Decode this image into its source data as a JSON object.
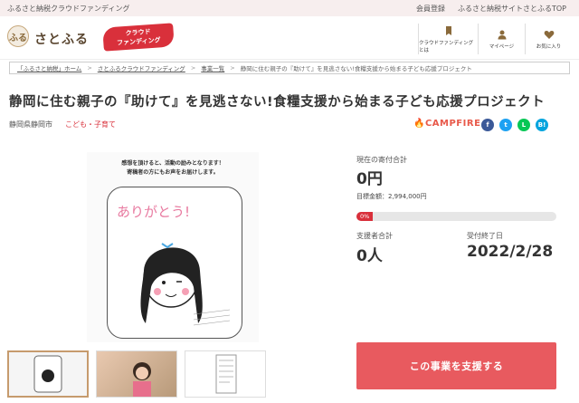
{
  "topbar": {
    "site_label": "ふるさと納税クラウドファンディング",
    "register": "会員登録",
    "top_link": "ふるさと納税サイトさとふるTOP"
  },
  "header": {
    "logo_text": "さとふる",
    "logo_mark": "ふる",
    "badge_line1": "クラウド",
    "badge_line2": "ファンディング",
    "nav": [
      {
        "label": "クラウドファンディングとは",
        "icon": "bookmark-icon"
      },
      {
        "label": "マイページ",
        "icon": "user-icon"
      },
      {
        "label": "お気に入り",
        "icon": "heart-icon"
      }
    ]
  },
  "breadcrumb": [
    "「ふるさと納税」ホーム",
    "さとふるクラウドファンディング",
    "事業一覧",
    "静岡に住む親子の『助けて』を見逃さない!食糧支援から始まる子ども応援プロジェクト"
  ],
  "project": {
    "title": "静岡に住む親子の『助けて』を見逃さない!食糧支援から始まる子ども応援プロジェクト",
    "location": "静岡県静岡市",
    "category": "こども・子育て",
    "platform": "CAMPFIRE",
    "image_caption_1": "感想を頂けると、活動の励みとなります！",
    "image_caption_2": "寄稿者の方にもお声をお届けします。",
    "image_text": "ありがとう!"
  },
  "share": [
    {
      "label": "f",
      "color": "#3b5998",
      "icon": "facebook-icon"
    },
    {
      "label": "t",
      "color": "#1da1f2",
      "icon": "twitter-icon"
    },
    {
      "label": "L",
      "color": "#06c755",
      "icon": "line-icon"
    },
    {
      "label": "B!",
      "color": "#00a4de",
      "icon": "hatena-icon"
    }
  ],
  "stats": {
    "current_label": "現在の寄付合計",
    "current_value": "0円",
    "goal_label": "目標金額：2,994,000円",
    "progress_text": "0%",
    "progress_fraction": 0.0,
    "supporters_label": "支援者合計",
    "supporters_value": "0人",
    "end_label": "受付終了日",
    "end_value": "2022/2/28"
  },
  "cta": {
    "support_label": "この事業を支援する"
  },
  "colors": {
    "accent": "#d9303b",
    "button": "#e85a5f"
  }
}
